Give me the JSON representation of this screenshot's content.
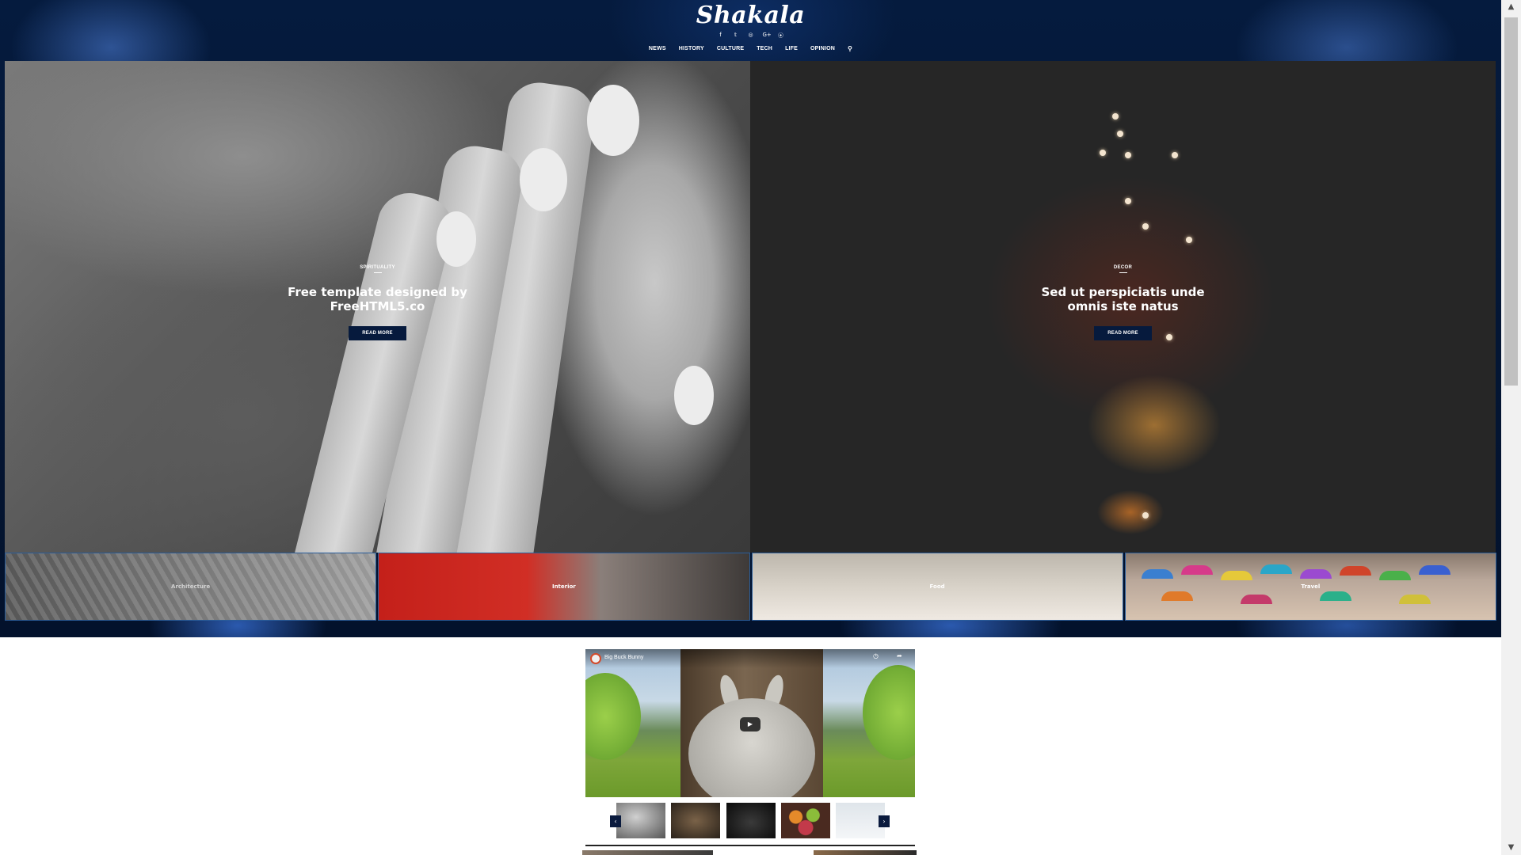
{
  "site": {
    "logo": "Shakala",
    "social_icons": [
      {
        "name": "facebook-icon",
        "glyph": "f"
      },
      {
        "name": "twitter-icon",
        "glyph": "𝕥"
      },
      {
        "name": "instagram-icon",
        "glyph": "◎"
      },
      {
        "name": "google-plus-icon",
        "glyph": "G+"
      },
      {
        "name": "rss-icon",
        "glyph": "⦿"
      }
    ]
  },
  "nav": {
    "items": [
      "NEWS",
      "HISTORY",
      "CULTURE",
      "TECH",
      "LIFE",
      "OPINION"
    ],
    "search_icon": "search-icon"
  },
  "hero": [
    {
      "category": "SPIRITUALITY",
      "title": "Free template designed by FreeHTML5.co",
      "button": "READ MORE"
    },
    {
      "category": "DECOR",
      "title": "Sed ut perspiciatis unde omnis iste natus",
      "button": "READ MORE"
    }
  ],
  "categories": [
    "Architecture",
    "Interior",
    "Food",
    "Travel"
  ],
  "video": {
    "title": "Big Buck Bunny",
    "play_icon": "play-icon"
  },
  "carousel": {
    "prev": "‹",
    "next": "›"
  },
  "colors": {
    "header_bg": "#051b3e",
    "button_bg": "#061a3d",
    "accent": "#2a5d9a"
  }
}
